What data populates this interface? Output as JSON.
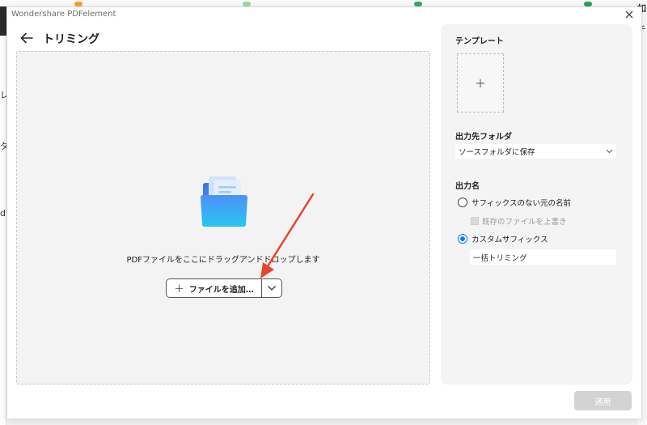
{
  "app": {
    "title": "Wondershare PDFelement"
  },
  "header": {
    "title": "トリミング"
  },
  "drop_zone": {
    "instruction": "PDFファイルをここにドラッグアンドドロップします",
    "add_button_label": "ファイルを追加…"
  },
  "side_panel": {
    "template_label": "テンプレート",
    "template_add_symbol": "+",
    "output_folder_label": "出力先フォルダ",
    "output_folder_value": "ソースフォルダに保存",
    "output_name_label": "出力名",
    "option_no_suffix": "サフィックスのない元の名前",
    "overwrite_label": "既存のファイルを上書き",
    "option_custom_suffix": "カスタムサフィックス",
    "custom_suffix_value": "一括トリミング",
    "selected_option": "custom_suffix"
  },
  "footer": {
    "apply_label": "適用"
  },
  "background": {
    "left_glyphs": [
      "レ",
      "ダ",
      "d"
    ],
    "right_glyphs": [
      "如",
      "チ"
    ]
  },
  "colors": {
    "accent": "#1a73e8",
    "annotation_arrow": "#e8452c",
    "folder_gradient_top": "#4f8ff7",
    "folder_gradient_bottom": "#27c7f2"
  }
}
